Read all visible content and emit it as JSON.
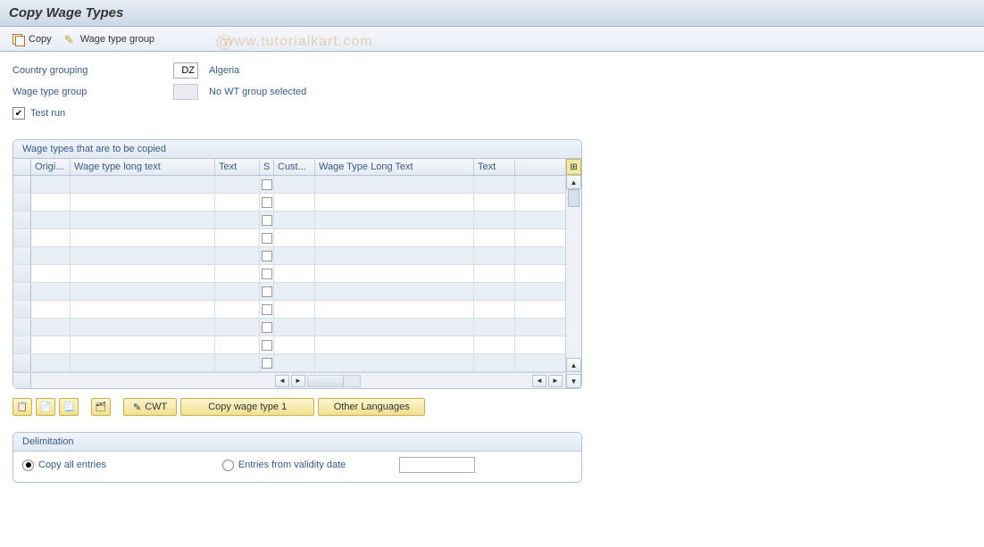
{
  "title": "Copy Wage Types",
  "toolbar": {
    "copy_label": "Copy",
    "wage_group_label": "Wage type group"
  },
  "watermark": "www.tutorialkart.com",
  "form": {
    "country_grouping_label": "Country grouping",
    "country_grouping_value": "DZ",
    "country_grouping_desc": "Algeria",
    "wage_type_group_label": "Wage type group",
    "wage_type_group_value": "",
    "wage_type_group_desc": "No WT group selected",
    "test_run_label": "Test run",
    "test_run_checked": true
  },
  "table": {
    "title": "Wage types that are to be copied",
    "columns": {
      "origi": "Origi...",
      "wt_long_text1": "Wage type long text",
      "text1": "Text",
      "s": "S",
      "cust": "Cust...",
      "wt_long_text2": "Wage Type Long Text",
      "text2": "Text"
    },
    "row_count": 11
  },
  "buttons": {
    "cwt": "CWT",
    "copy_wt1": "Copy wage type 1",
    "other_lang": "Other Languages"
  },
  "delim": {
    "title": "Delimitation",
    "copy_all": "Copy all entries",
    "entries_from": "Entries from validity date",
    "date_value": ""
  }
}
